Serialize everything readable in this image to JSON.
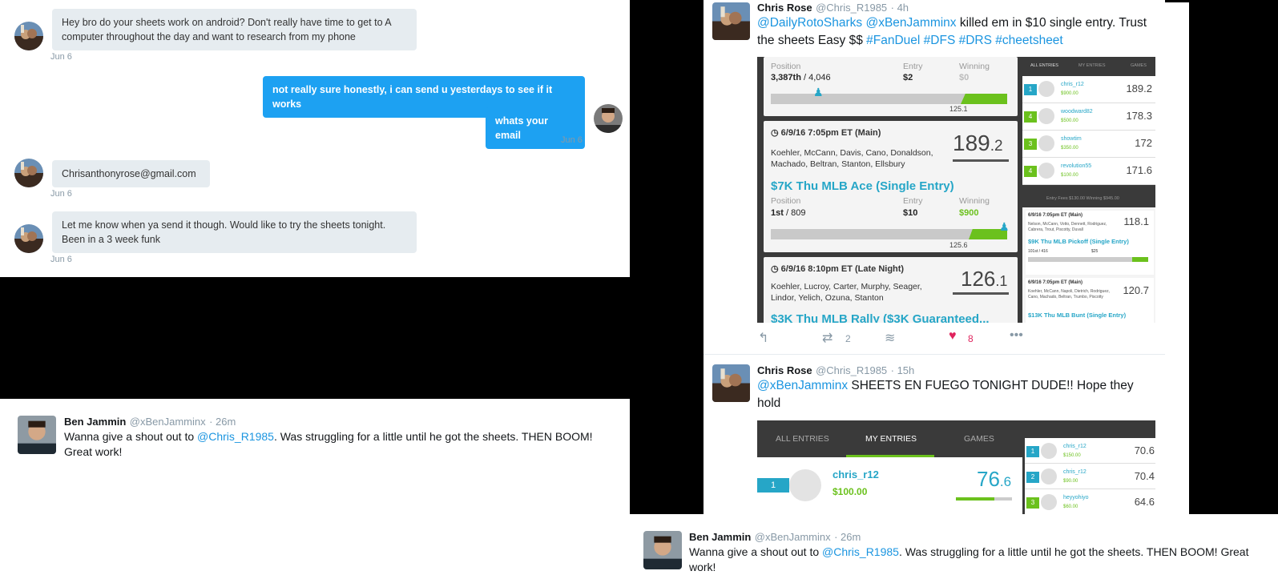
{
  "dm": {
    "messages": [
      {
        "side": "in",
        "text": "Hey bro do your sheets work on android? Don't really have time to get to A computer throughout the day and want to research from my phone",
        "time": "Jun 6"
      },
      {
        "side": "out",
        "text": "not really sure honestly, i can send u yesterdays to see if it works"
      },
      {
        "side": "out",
        "text": "whats your email",
        "time": "Jun 6"
      },
      {
        "side": "in",
        "text": "Chrisanthonyrose@gmail.com",
        "time": "Jun 6"
      },
      {
        "side": "in",
        "text": "Let me know when ya send it though. Would like to try the sheets tonight. Been in a 3 week funk",
        "time": "Jun 6"
      }
    ]
  },
  "tweet1": {
    "name": "Chris Rose",
    "handle": "@Chris_R1985",
    "time": "· 4h",
    "text_parts": [
      "@DailyRotoSharks",
      " ",
      "@xBenJamminx",
      " killed em in $10 single entry. Trust the sheets Easy $$ ",
      "#FanDuel",
      " ",
      "#DFS",
      " ",
      "#DRS",
      " ",
      "#cheetsheet"
    ],
    "retweets": "2",
    "likes": "8",
    "screenshot": {
      "top_card": {
        "position_label": "Position",
        "position": "3,387th",
        "position_total": "/ 4,046",
        "entry_label": "Entry",
        "entry": "$2",
        "winning_label": "Winning",
        "winning": "$0",
        "bar_value": "125.1"
      },
      "card1": {
        "date": "6/9/16 7:05pm ET (Main)",
        "players": "Koehler, McCann, Davis, Cano, Donaldson, Machado, Beltran, Stanton, Ellsbury",
        "score_main": "189",
        "score_dec": ".2",
        "contest": "$7K Thu MLB Ace (Single Entry)",
        "position_label": "Position",
        "position": "1st",
        "position_total": "/ 809",
        "entry_label": "Entry",
        "entry": "$10",
        "winning_label": "Winning",
        "winning": "$900",
        "bar_value": "125.6"
      },
      "card2": {
        "date": "6/9/16 8:10pm ET (Late Night)",
        "players": "Koehler, Lucroy, Carter, Murphy, Seager, Lindor, Yelich, Ozuna, Stanton",
        "score_main": "126",
        "score_dec": ".1",
        "contest": "$3K Thu MLB Rally ($3K Guaranteed..."
      },
      "side_tabs": [
        "ALL ENTRIES",
        "MY ENTRIES",
        "GAMES"
      ],
      "side_rows": [
        {
          "rank": "1",
          "name": "chris_r12",
          "money": "$900.00",
          "score": "189.2",
          "color": "#26a6c7"
        },
        {
          "rank": "4",
          "name": "woodward82",
          "money": "$500.00",
          "score": "178.3",
          "color": "#6bc11d"
        },
        {
          "rank": "3",
          "name": "showtim",
          "money": "$350.00",
          "score": "172",
          "color": "#6bc11d"
        },
        {
          "rank": "4",
          "name": "revolution55",
          "money": "$100.00",
          "score": "171.6",
          "color": "#6bc11d"
        }
      ],
      "side_mini_top": "Entry Fees $130.00   Winning $945.00",
      "side_card1": {
        "date": "6/9/16 7:05pm ET (Main)",
        "players": "Nelson, McCann, Votto, Dennett, Rodriguez, Cabrera, Trout, Piscotty, Duvall",
        "score": "118.1",
        "contest": "$9K Thu MLB Pickoff (Single Entry)",
        "pos": "101st / 416",
        "entry": "$25"
      },
      "side_card2": {
        "date": "6/9/16 7:05pm ET (Main)",
        "players": "Koehler, McCann, Napoli, Dietrich, Rodriguez, Cano, Machado, Beltran, Trumbo, Piscotty",
        "score": "120.7",
        "contest": "$13K Thu MLB Bunt (Single Entry)"
      }
    }
  },
  "tweet2": {
    "name": "Chris Rose",
    "handle": "@Chris_R1985",
    "time": "· 15h",
    "text_parts": [
      "@xBenJamminx",
      " SHEETS EN FUEGO TONIGHT DUDE!! Hope they hold"
    ],
    "screenshot": {
      "tabs": [
        "ALL ENTRIES",
        "MY ENTRIES",
        "GAMES"
      ],
      "row": {
        "rank": "1",
        "name": "chris_r12",
        "money": "$100.00",
        "score_main": "76",
        "score_dec": ".6"
      },
      "side_rows": [
        {
          "rank": "1",
          "name": "chris_r12",
          "money": "$150.00",
          "score": "70.6",
          "color": "#26a6c7"
        },
        {
          "rank": "2",
          "name": "chris_r12",
          "money": "$90.00",
          "score": "70.4",
          "color": "#26a6c7"
        },
        {
          "rank": "3",
          "name": "heyyohiyo",
          "money": "$60.00",
          "score": "64.6",
          "color": "#6bc11d"
        }
      ]
    }
  },
  "tweet3": {
    "name": "Ben Jammin",
    "handle": "@xBenJamminx",
    "time": "· 26m",
    "text_parts": [
      "Wanna give a shout out to ",
      "@Chris_R1985",
      ". Was struggling for a little until he got the sheets. THEN BOOM! Great work!"
    ]
  },
  "tweet4": {
    "name": "Ben Jammin",
    "handle": "@xBenJamminx",
    "time": "· 26m",
    "text_parts": [
      "Wanna give a shout out to ",
      "@Chris_R1985",
      ". Was struggling for a little until he got the sheets. THEN BOOM! Great work!"
    ]
  },
  "colors": {
    "twitter_blue": "#1da1f2",
    "bubble_gray": "#e6ecf0",
    "fanduel_green": "#6bc11d",
    "fanduel_teal": "#26a6c7",
    "like_red": "#e0245e"
  }
}
